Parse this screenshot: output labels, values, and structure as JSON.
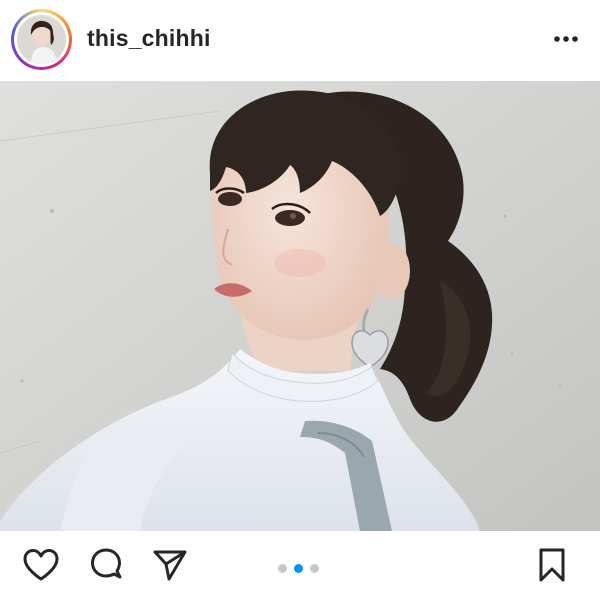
{
  "post": {
    "username": "this_chihhi"
  },
  "header": {
    "more_icon": "more-horizontal-icon"
  },
  "actions": {
    "icons": [
      "heart-icon",
      "comment-icon",
      "send-icon",
      "bookmark-icon"
    ]
  },
  "carousel": {
    "total": 3,
    "active_index": 2
  },
  "colors": {
    "active_dot": "#0095f6",
    "inactive_dot": "#c7c7c7",
    "text": "#262626"
  }
}
